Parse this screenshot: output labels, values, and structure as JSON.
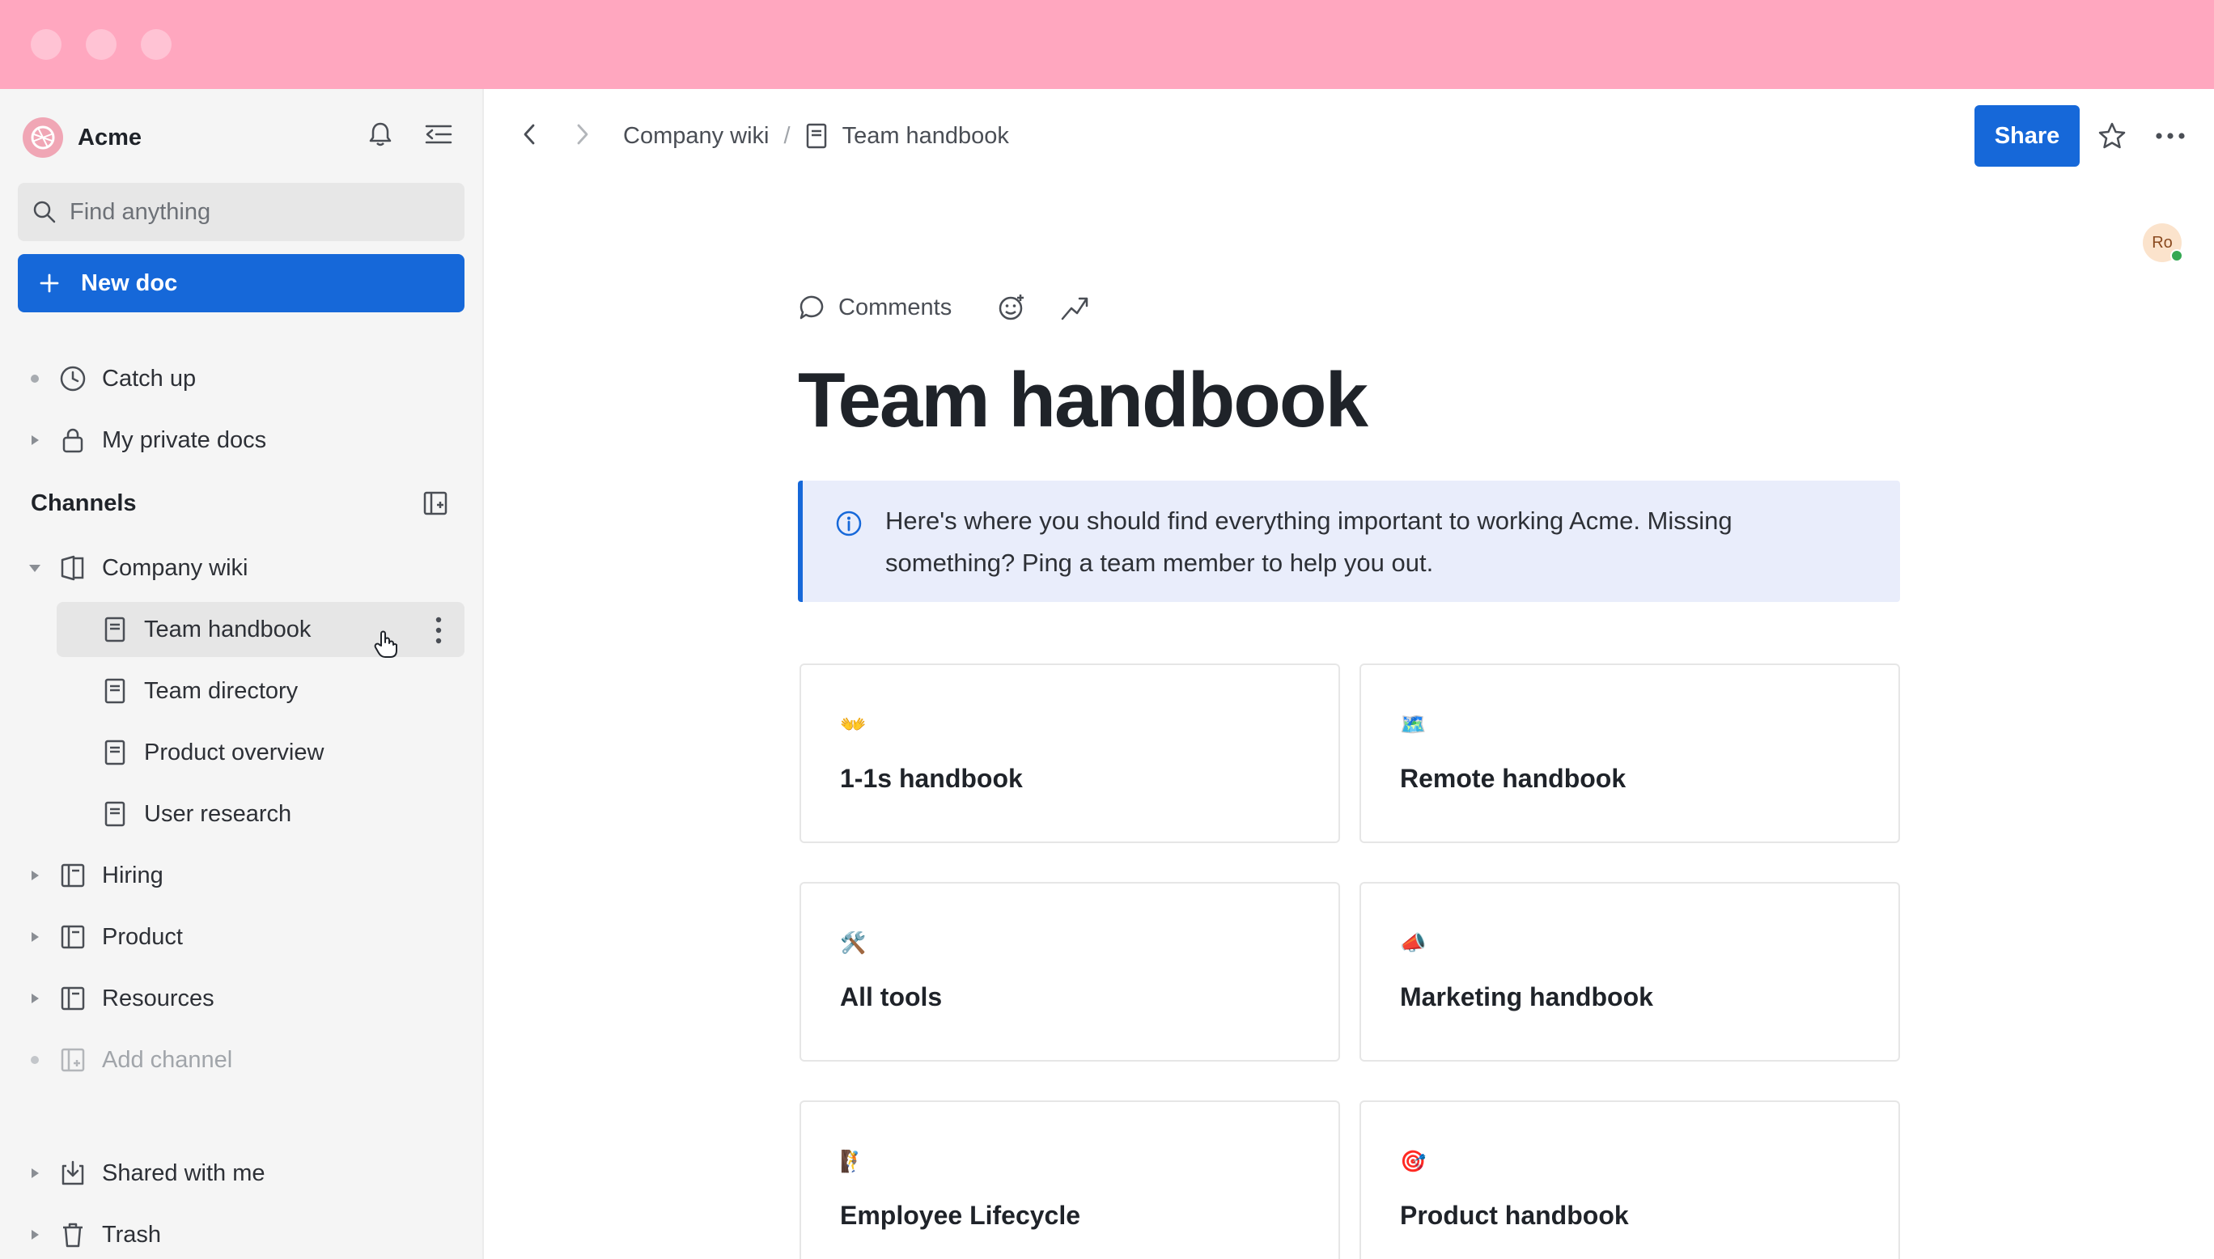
{
  "colors": {
    "titlebar": "#ffa7bf",
    "accent": "#1668d9",
    "sidebar_bg": "#f5f5f5",
    "callout_bg": "#e9edfb"
  },
  "sidebar": {
    "workspace_name": "Acme",
    "search_placeholder": "Find anything",
    "new_doc_label": "New doc",
    "top_items": [
      {
        "label": "Catch up",
        "icon": "clock-icon"
      },
      {
        "label": "My private docs",
        "icon": "lock-icon"
      }
    ],
    "channels_label": "Channels",
    "channels": [
      {
        "label": "Company wiki",
        "icon": "wiki-icon",
        "expanded": true,
        "children": [
          "Team handbook",
          "Team directory",
          "Product overview",
          "User research"
        ]
      },
      {
        "label": "Hiring",
        "icon": "channel-icon"
      },
      {
        "label": "Product",
        "icon": "channel-icon"
      },
      {
        "label": "Resources",
        "icon": "channel-icon"
      }
    ],
    "add_channel_label": "Add channel",
    "bottom_items": [
      {
        "label": "Shared with me",
        "icon": "inbox-icon"
      },
      {
        "label": "Trash",
        "icon": "trash-icon"
      }
    ]
  },
  "header": {
    "breadcrumb": [
      "Company wiki",
      "Team handbook"
    ],
    "share_label": "Share"
  },
  "presence_initials": "Ro",
  "doc": {
    "comments_label": "Comments",
    "title": "Team handbook",
    "callout_text": "Here's where you should find everything important to working Acme. Missing something? Ping a team member to help you out.",
    "cards": [
      {
        "emoji": "👐",
        "title": "1-1s handbook"
      },
      {
        "emoji": "🗺️",
        "title": "Remote handbook"
      },
      {
        "emoji": "🛠️",
        "title": "All tools"
      },
      {
        "emoji": "📣",
        "title": "Marketing handbook"
      },
      {
        "emoji": "🧗",
        "title": "Employee Lifecycle"
      },
      {
        "emoji": "🎯",
        "title": "Product handbook"
      }
    ]
  }
}
